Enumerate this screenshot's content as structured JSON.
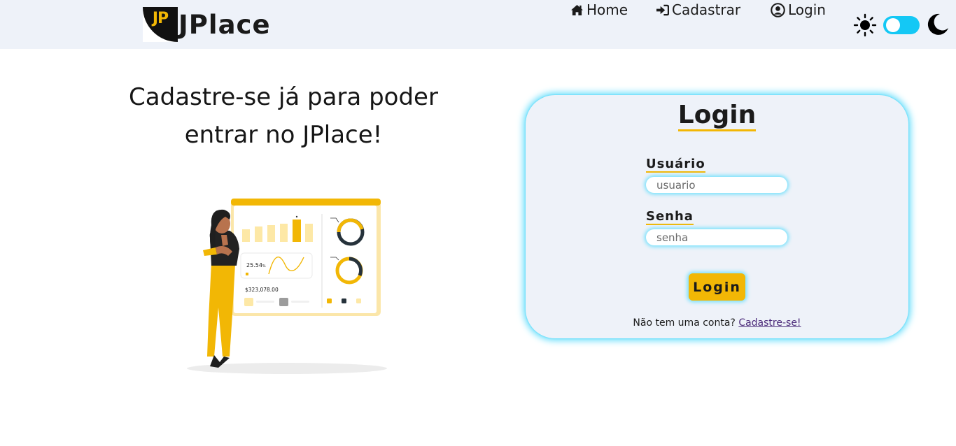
{
  "navbar": {
    "logo_text": "JP",
    "brand_name": "JPlace",
    "links": [
      {
        "label": "Home",
        "icon": "home-icon"
      },
      {
        "label": "Cadastrar",
        "icon": "sign-in-icon"
      },
      {
        "label": "Login",
        "icon": "user-circle-icon"
      }
    ],
    "theme_toggle": {
      "light_icon": "sun-icon",
      "dark_icon": "moon-icon",
      "toggle_color": "#14c8f5"
    }
  },
  "hero": {
    "headline_line1": "Cadastre-se já para poder",
    "headline_line2": "entrar no JPlace!",
    "illustration": {
      "stat_percent": "25.54",
      "stat_percent_unit": "%",
      "stat_money": "$323,078.00"
    }
  },
  "login_card": {
    "title": "Login",
    "username_label": "Usuário",
    "username_placeholder": "usuario",
    "password_label": "Senha",
    "password_placeholder": "senha",
    "submit_label": "Login",
    "no_account_text": "Não tem uma conta?",
    "signup_link": "Cadastre-se!"
  },
  "colors": {
    "accent": "#f2b705",
    "glow": "#14c8f5",
    "navbar_bg": "#eef2f9"
  }
}
